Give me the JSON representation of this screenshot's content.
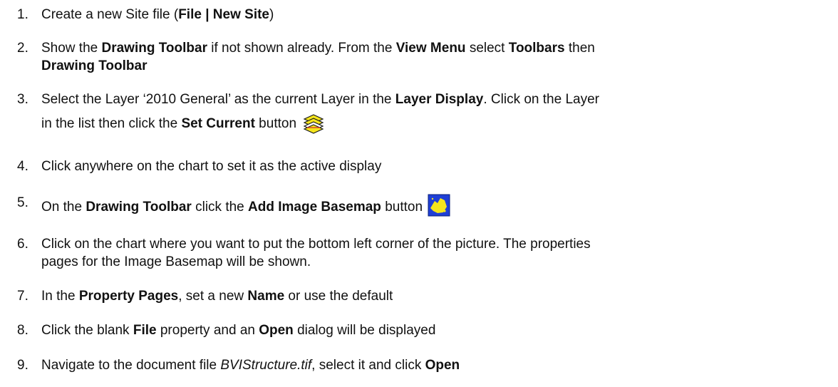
{
  "steps": [
    {
      "number": "1.",
      "t1": "Create a new Site file (",
      "b1": "File | New Site",
      "t2": ")"
    },
    {
      "number": "2.",
      "t1": "Show the ",
      "b1": "Drawing Toolbar",
      "t2": " if not shown already.  From the ",
      "b2": "View Menu",
      "t3": " select ",
      "b3": "Toolbars",
      "t4": " then",
      "b4": "Drawing Toolbar"
    },
    {
      "number": "3.",
      "t1": "Select the Layer ‘2010 General’ as the current Layer in the ",
      "b1": "Layer Display",
      "t2": ".  Click on the Layer",
      "t3": "in the list then click the ",
      "b2": "Set Current",
      "t4": " button",
      "icon": "set-current-layers-icon"
    },
    {
      "number": "4.",
      "t1": "Click anywhere on the chart to set it as the active display"
    },
    {
      "number": "5.",
      "t1": "On the ",
      "b1": "Drawing Toolbar",
      "t2": " click the ",
      "b2": "Add Image Basemap",
      "t3": " button",
      "icon": "add-image-basemap-icon"
    },
    {
      "number": "6.",
      "t1": "Click on the chart where you want to put the bottom left corner of the picture.  The properties",
      "t2": "pages for the Image Basemap will be shown."
    },
    {
      "number": "7.",
      "t1": "In the ",
      "b1": "Property Pages",
      "t2": ", set a new ",
      "b2": "Name",
      "t3": " or use the default"
    },
    {
      "number": "8.",
      "t1": "Click the blank ",
      "b1": "File",
      "t2": " property and an ",
      "b2": "Open",
      "t3": " dialog will be displayed"
    },
    {
      "number": "9.",
      "t1": "Navigate to the document file ",
      "i1": "BVIStructure.tif",
      "t2": ", select it and click ",
      "b1": "Open"
    }
  ],
  "colors": {
    "text": "#111111",
    "icon_yellow": "#f5e51c",
    "icon_blue": "#1f3fd6"
  }
}
